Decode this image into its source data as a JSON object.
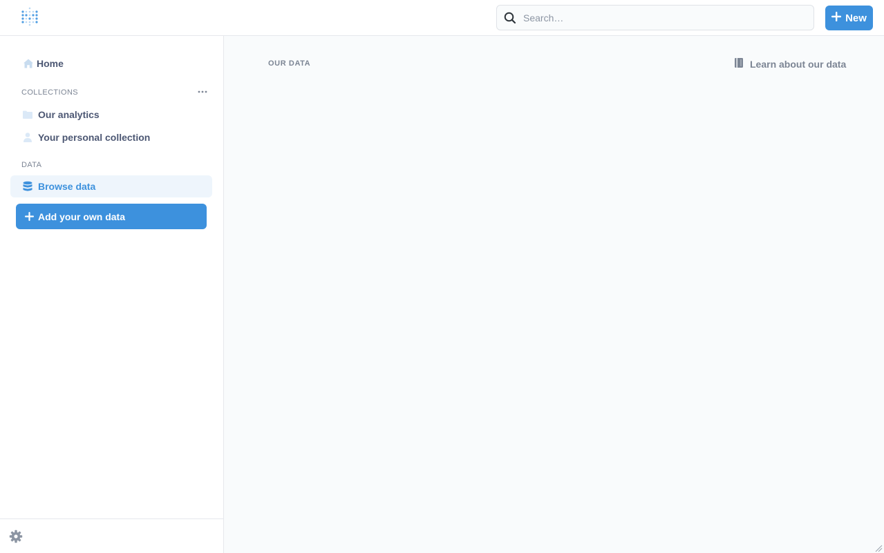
{
  "topbar": {
    "search": {
      "placeholder": "Search…",
      "value": ""
    },
    "new_label": "New"
  },
  "sidebar": {
    "home_label": "Home",
    "collections_label": "COLLECTIONS",
    "collections": [
      {
        "label": "Our analytics",
        "icon": "folder-icon"
      },
      {
        "label": "Your personal collection",
        "icon": "person-icon"
      }
    ],
    "data_label": "DATA",
    "browse_label": "Browse data",
    "add_data_label": "Add your own data"
  },
  "main": {
    "title": "OUR DATA",
    "learn_label": "Learn about our data"
  },
  "colors": {
    "brand": "#3d91dd",
    "active_bg": "#eef5fc",
    "main_bg": "#f9fbfc",
    "text": "#4c5773",
    "muted": "#7c8594"
  }
}
